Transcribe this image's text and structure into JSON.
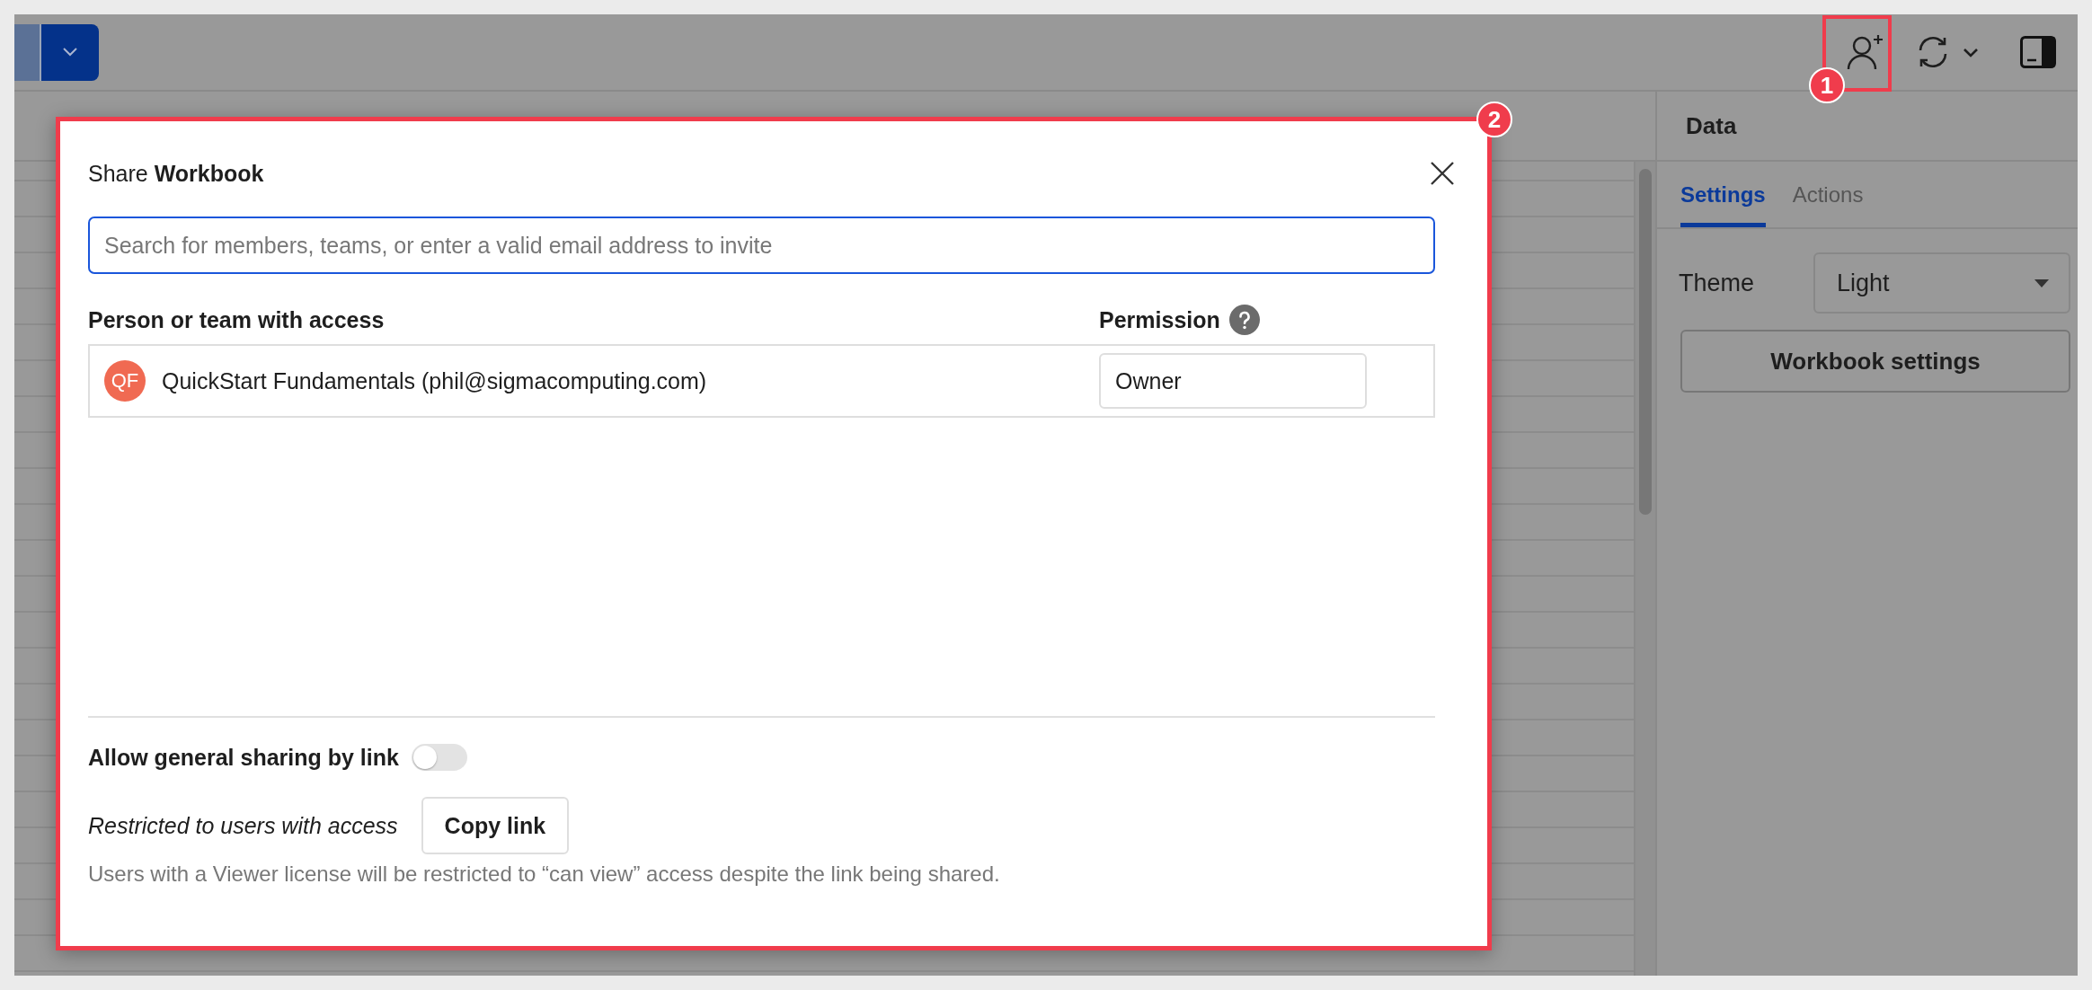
{
  "toolbar": {
    "annotation": "1"
  },
  "side_panel": {
    "title": "Data",
    "tabs": [
      {
        "label": "Settings",
        "selected": true
      },
      {
        "label": "Actions",
        "selected": false
      }
    ],
    "theme": {
      "label": "Theme",
      "value": "Light"
    },
    "button": "Workbook settings"
  },
  "share_dialog": {
    "annotation": "2",
    "title": "Share **Workbook**",
    "search": {
      "placeholder": "Search for members, teams, or enter a valid email address to invite"
    },
    "columns": [
      "Person or team with access",
      "Permission"
    ],
    "members": [
      {
        "initials": "QF",
        "name": "QuickStart Fundamentals (phil@sigmacomputing.com)",
        "permission": "Owner"
      }
    ],
    "link_sharing": {
      "label": "Allow general sharing by link",
      "on": false
    },
    "restriction": "Restricted to users with access",
    "copy_button": "Copy link",
    "note": "Users with a Viewer license will be restricted to “can view” access despite the link being shared."
  }
}
